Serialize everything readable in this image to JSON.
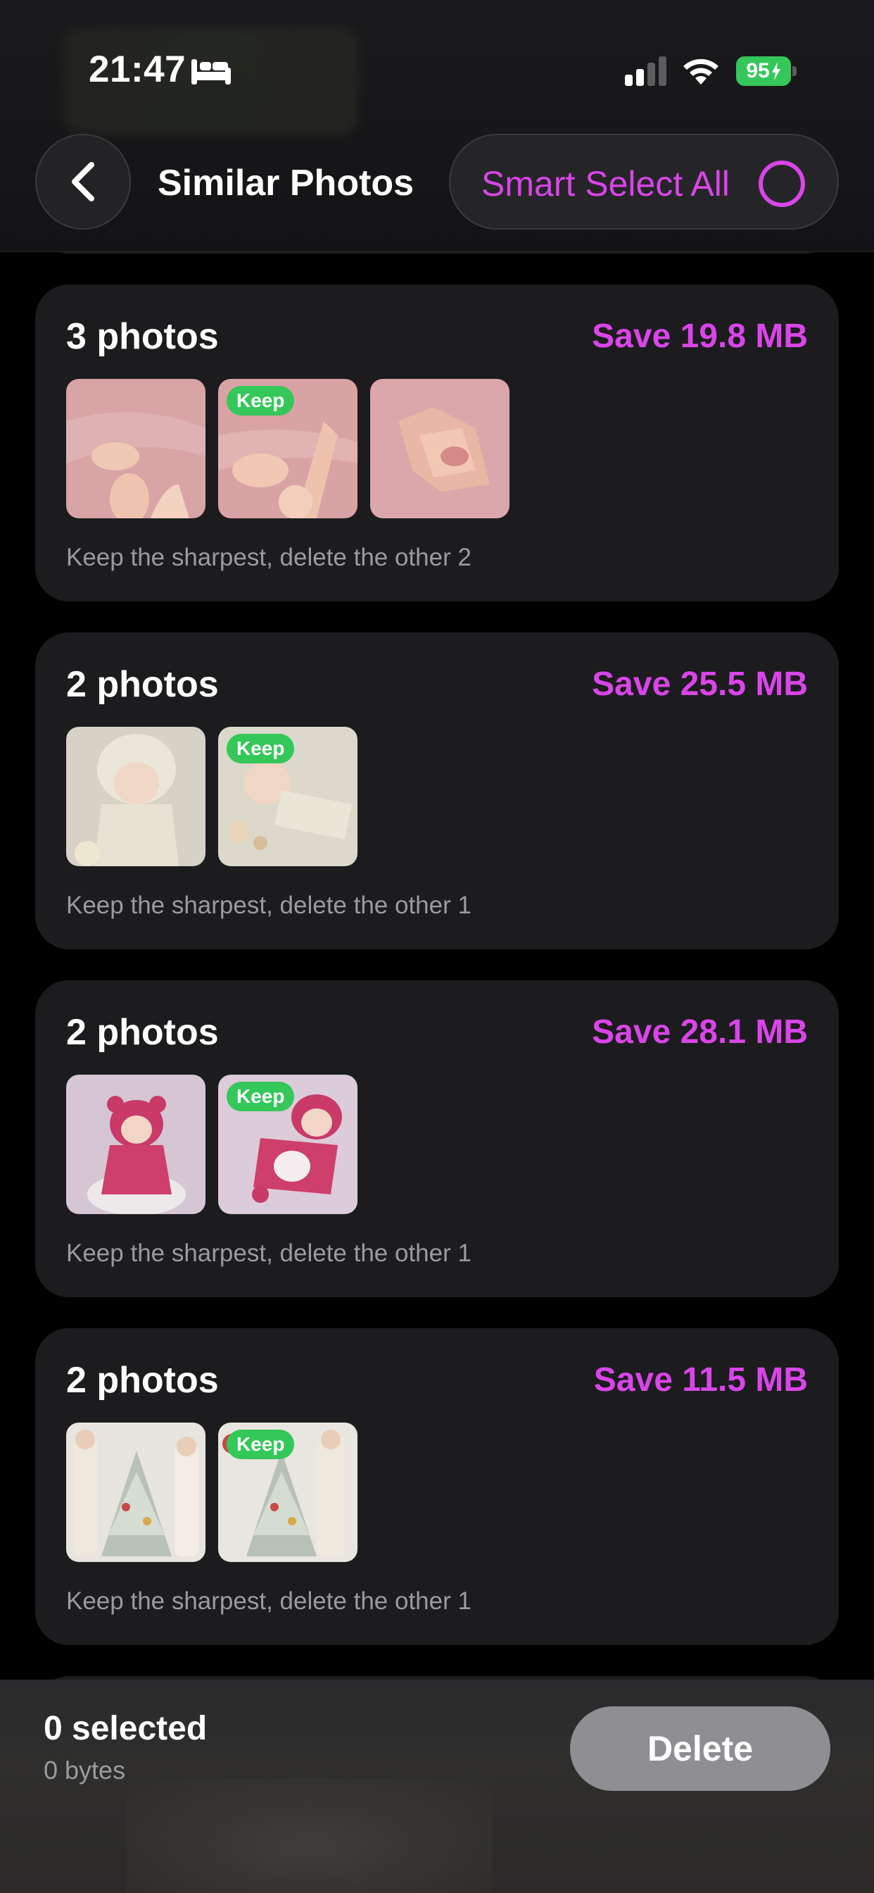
{
  "status_bar": {
    "time": "21:47",
    "battery_level": "95",
    "icons": [
      "bed-icon",
      "cellular-signal-icon",
      "wifi-icon",
      "battery-charging-icon"
    ]
  },
  "nav": {
    "title": "Similar Photos",
    "back_icon": "chevron-left-icon",
    "smart_select_label": "Smart Select All"
  },
  "groups": [
    {
      "count_label": "3 photos",
      "save_label": "Save 19.8 MB",
      "hint": "Keep the sharpest, delete the other 2",
      "thumbnails": [
        "baby-hand-pink-photo",
        "baby-hand-pink-photo",
        "hands-pink-photo"
      ],
      "keep_badge": "Keep",
      "keep_index": 1
    },
    {
      "count_label": "2 photos",
      "save_label": "Save 25.5 MB",
      "hint": "Keep the sharpest, delete the other 1",
      "thumbnails": [
        "baby-white-bonnet-photo",
        "baby-white-lying-photo"
      ],
      "keep_badge": "Keep",
      "keep_index": 1
    },
    {
      "count_label": "2 photos",
      "save_label": "Save 28.1 MB",
      "hint": "Keep the sharpest, delete the other 1",
      "thumbnails": [
        "baby-pink-bear-photo",
        "baby-pink-bear-photo"
      ],
      "keep_badge": "Keep",
      "keep_index": 1
    },
    {
      "count_label": "2 photos",
      "save_label": "Save 11.5 MB",
      "hint": "Keep the sharpest, delete the other 1",
      "thumbnails": [
        "christmas-tree-family-photo",
        "christmas-tree-family-photo"
      ],
      "keep_badge": "Keep",
      "keep_index": 1
    }
  ],
  "footer": {
    "selected_label": "0 selected",
    "bytes_label": "0 bytes",
    "delete_label": "Delete"
  },
  "colors": {
    "accent": "#d945e8",
    "keep_green": "#34c759",
    "card_bg": "#1c1c1e",
    "delete_disabled": "#8e8e93"
  }
}
